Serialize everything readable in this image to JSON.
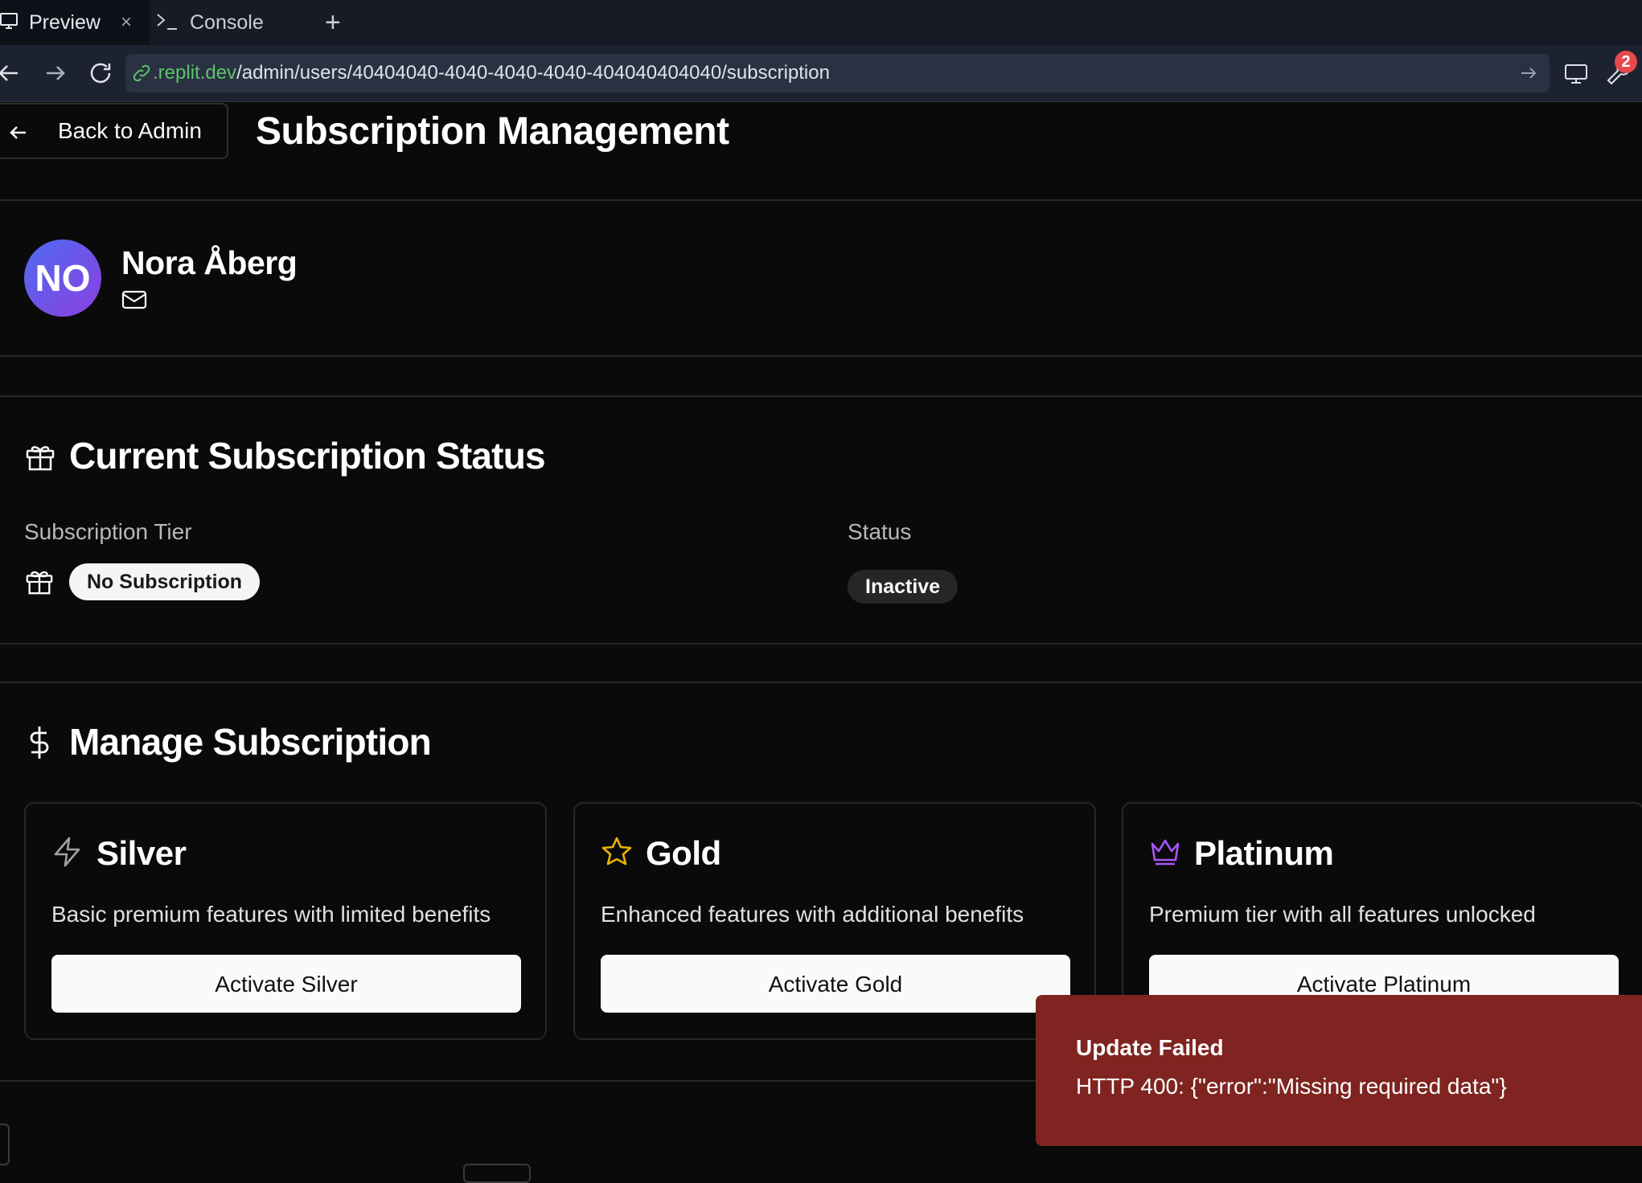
{
  "browser": {
    "tabs": [
      {
        "label": "Preview",
        "active": true,
        "icon": "monitor-icon"
      },
      {
        "label": "Console",
        "active": false,
        "icon": "terminal-icon"
      }
    ],
    "close_glyph": "×",
    "new_tab_glyph": "+",
    "url_domain": ".replit.dev",
    "url_path": "/admin/users/40404040-4040-4040-4040-404040404040/subscription",
    "devtools_badge": "2"
  },
  "header": {
    "back_label": "Back to Admin",
    "title": "Subscription Management"
  },
  "user": {
    "initials": "NO",
    "name": "Nora Åberg"
  },
  "status_section": {
    "title": "Current Subscription Status",
    "tier_label": "Subscription Tier",
    "tier_value": "No Subscription",
    "status_label": "Status",
    "status_value": "Inactive"
  },
  "manage_section": {
    "title": "Manage Subscription",
    "plans": [
      {
        "name": "Silver",
        "description": "Basic premium features with limited benefits",
        "button": "Activate Silver",
        "icon": "zap-icon",
        "icon_color": "#a3a3a3"
      },
      {
        "name": "Gold",
        "description": "Enhanced features with additional benefits",
        "button": "Activate Gold",
        "icon": "star-icon",
        "icon_color": "#eab308"
      },
      {
        "name": "Platinum",
        "description": "Premium tier with all features unlocked",
        "button": "Activate Platinum",
        "icon": "crown-icon",
        "icon_color": "#a855f7"
      }
    ]
  },
  "toast": {
    "title": "Update Failed",
    "message": "HTTP 400: {\"error\":\"Missing required data\"}",
    "color": "#7f2420"
  }
}
